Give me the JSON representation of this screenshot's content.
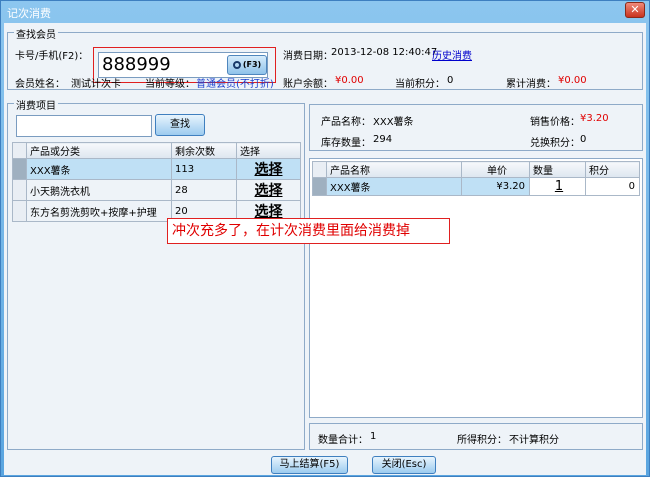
{
  "window": {
    "title": "记次消费",
    "close_label": "✕"
  },
  "member_search": {
    "legend": "查找会员",
    "card_label": "卡号/手机(F2)：",
    "card_value": "888999",
    "search_icon": "magnifier-icon",
    "search_button": "(F3)",
    "date_label": "消费日期：",
    "date_value": "2013-12-08 12:40:47",
    "history_link": "历史消费",
    "name_label": "会员姓名：",
    "name_value": "测试计次卡",
    "level_label": "当前等级：",
    "level_value": "普通会员(不打折)",
    "balance_label": "账户余额：",
    "balance_value": "¥0.00",
    "points_label": "当前积分：",
    "points_value": "0",
    "total_label": "累计消费：",
    "total_value": "¥0.00"
  },
  "consume_items": {
    "legend": "消费项目",
    "search_placeholder": "",
    "search_button": "查找",
    "columns": [
      "产品或分类",
      "剩余次数",
      "选择"
    ],
    "rows": [
      {
        "name": "XXX薯条",
        "remaining": "113",
        "action": "选择"
      },
      {
        "name": "小天鹅洗衣机",
        "remaining": "28",
        "action": "选择"
      },
      {
        "name": "东方名剪洗剪吹+按摩+护理",
        "remaining": "20",
        "action": "选择"
      }
    ]
  },
  "product_info": {
    "name_label": "产品名称：",
    "name_value": "XXX薯条",
    "price_label": "销售价格：",
    "price_value": "¥3.20",
    "stock_label": "库存数量：",
    "stock_value": "294",
    "exchange_label": "兑换积分：",
    "exchange_value": "0"
  },
  "cart": {
    "columns": [
      "产品名称",
      "单价",
      "数量",
      "积分"
    ],
    "rows": [
      {
        "name": "XXX薯条",
        "price": "¥3.20",
        "qty": "1",
        "points": "0"
      }
    ]
  },
  "summary": {
    "qty_label": "数量合计：",
    "qty_value": "1",
    "points_label": "所得积分：",
    "points_value": "不计算积分"
  },
  "annotation": "冲次充多了，在计次消费里面给消费掉",
  "footer": {
    "checkout_button": "马上结算(F5)",
    "close_button": "关闭(Esc)"
  }
}
